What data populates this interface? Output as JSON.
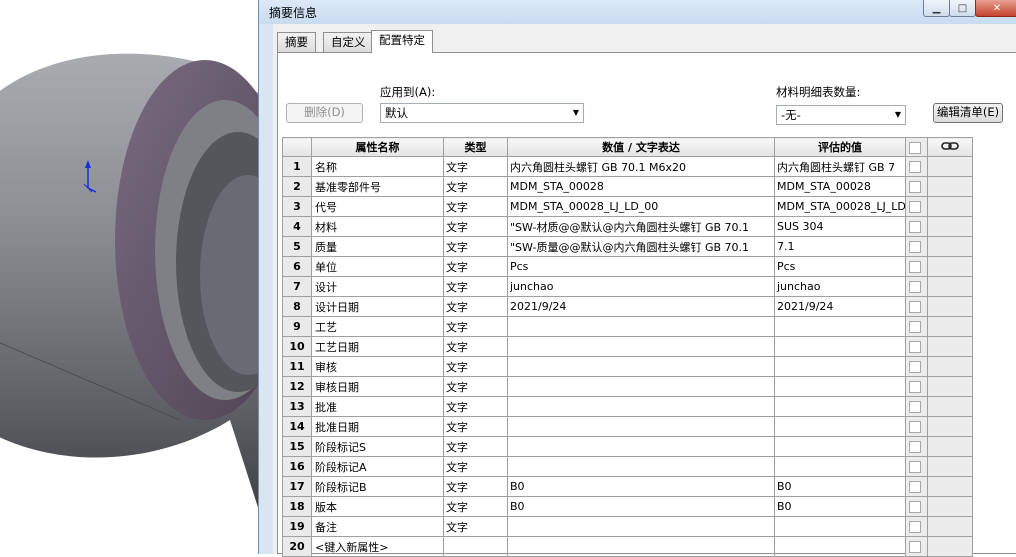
{
  "dialog": {
    "title": "摘要信息",
    "window_buttons": {
      "minimize": "▁",
      "maximize": "□",
      "close": "✕"
    }
  },
  "tabs": [
    {
      "label": "摘要",
      "active": false
    },
    {
      "label": "自定义",
      "active": false
    },
    {
      "label": "配置特定",
      "active": true
    }
  ],
  "toolbar": {
    "delete_label": "删除(D)",
    "apply_to_label": "应用到(A):",
    "apply_to_value": "默认",
    "bom_qty_label": "材料明细表数量:",
    "bom_qty_value": "-无-",
    "edit_list_label": "编辑清单(E)"
  },
  "table": {
    "headers": {
      "name": "属性名称",
      "type": "类型",
      "value": "数值 / 文字表达",
      "evaluated": "评估的值",
      "link_icon": "link-icon"
    },
    "rows": [
      {
        "num": "1",
        "name": "名称",
        "type": "文字",
        "value": "内六角圆柱头螺钉 GB 70.1 M6x20",
        "evaluated": "内六角圆柱头螺钉 GB 7"
      },
      {
        "num": "2",
        "name": "基准零部件号",
        "type": "文字",
        "value": "MDM_STA_00028",
        "evaluated": "MDM_STA_00028"
      },
      {
        "num": "3",
        "name": "代号",
        "type": "文字",
        "value": "MDM_STA_00028_LJ_LD_00",
        "evaluated": "MDM_STA_00028_LJ_LD_"
      },
      {
        "num": "4",
        "name": "材料",
        "type": "文字",
        "value": "\"SW-材质@@默认@内六角圆柱头螺钉 GB 70.1",
        "evaluated": "SUS 304"
      },
      {
        "num": "5",
        "name": "质量",
        "type": "文字",
        "value": "\"SW-质量@@默认@内六角圆柱头螺钉 GB 70.1",
        "evaluated": "7.1"
      },
      {
        "num": "6",
        "name": "单位",
        "type": "文字",
        "value": "Pcs",
        "evaluated": "Pcs"
      },
      {
        "num": "7",
        "name": "设计",
        "type": "文字",
        "value": "junchao",
        "evaluated": "junchao"
      },
      {
        "num": "8",
        "name": "设计日期",
        "type": "文字",
        "value": "2021/9/24",
        "evaluated": "2021/9/24"
      },
      {
        "num": "9",
        "name": "工艺",
        "type": "文字",
        "value": "",
        "evaluated": ""
      },
      {
        "num": "10",
        "name": "工艺日期",
        "type": "文字",
        "value": "",
        "evaluated": ""
      },
      {
        "num": "11",
        "name": "审核",
        "type": "文字",
        "value": "",
        "evaluated": ""
      },
      {
        "num": "12",
        "name": "审核日期",
        "type": "文字",
        "value": "",
        "evaluated": ""
      },
      {
        "num": "13",
        "name": "批准",
        "type": "文字",
        "value": "",
        "evaluated": ""
      },
      {
        "num": "14",
        "name": "批准日期",
        "type": "文字",
        "value": "",
        "evaluated": ""
      },
      {
        "num": "15",
        "name": "阶段标记S",
        "type": "文字",
        "value": "",
        "evaluated": ""
      },
      {
        "num": "16",
        "name": "阶段标记A",
        "type": "文字",
        "value": "",
        "evaluated": ""
      },
      {
        "num": "17",
        "name": "阶段标记B",
        "type": "文字",
        "value": "B0",
        "evaluated": "B0"
      },
      {
        "num": "18",
        "name": "版本",
        "type": "文字",
        "value": "B0",
        "evaluated": "B0"
      },
      {
        "num": "19",
        "name": "备注",
        "type": "文字",
        "value": "",
        "evaluated": ""
      },
      {
        "num": "20",
        "name": "<键入新属性>",
        "type": "",
        "value": "",
        "evaluated": ""
      }
    ]
  },
  "viewport": {
    "part_colors": {
      "outer": "#8e9096",
      "face": "#6a5b6e",
      "inner": "#55565c"
    },
    "axis_color": "#1533d6",
    "axis_icon": "triad-axis-icon"
  }
}
